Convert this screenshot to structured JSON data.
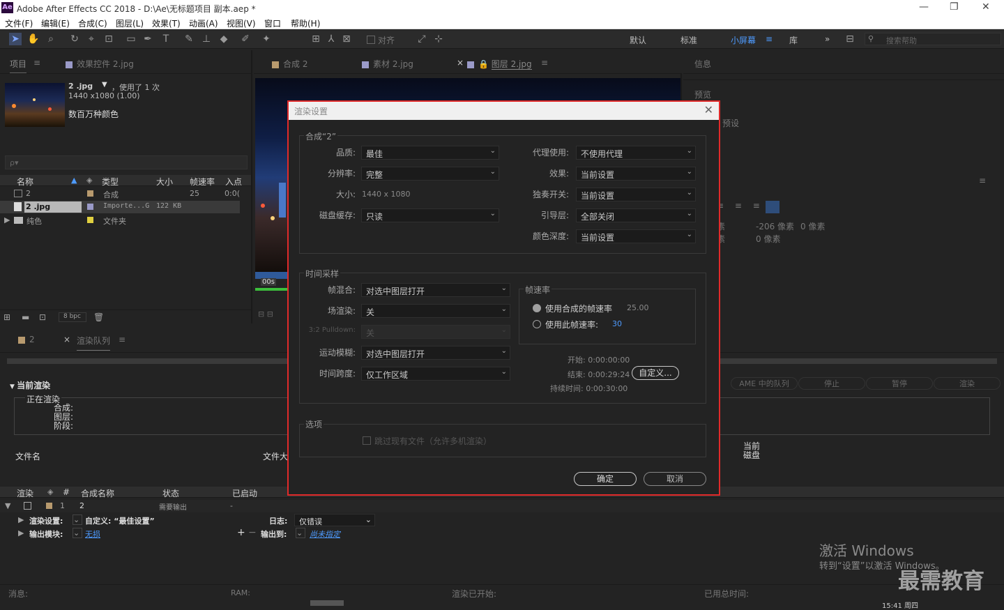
{
  "window": {
    "title": "Adobe After Effects CC 2018 - D:\\Ae\\无标题项目 副本.aep *",
    "logo": "Ae"
  },
  "menu": [
    "文件(F)",
    "编辑(E)",
    "合成(C)",
    "图层(L)",
    "效果(T)",
    "动画(A)",
    "视图(V)",
    "窗口",
    "帮助(H)"
  ],
  "toolbar": {
    "snap_label": "对齐",
    "workspaces": [
      "默认",
      "标准",
      "小屏幕",
      "库"
    ],
    "active_workspace": "小屏幕",
    "search_placeholder": "搜索帮助"
  },
  "project": {
    "tab_project": "项目",
    "tab_effects": "效果控件 2.jpg",
    "file_name": "2 .jpg",
    "file_usage": "，使用了 1 次",
    "file_dims": "1440 x1080 (1.00)",
    "file_colors": "数百万种颜色",
    "search_placeholder": "ρ▾",
    "columns": [
      "名称",
      "类型",
      "大小",
      "帧速率",
      "入点"
    ],
    "rows": [
      {
        "name": "2",
        "color": "#b89a6e",
        "type": "合成",
        "size": "",
        "fps": "25",
        "in": "0:0("
      },
      {
        "name": "2 .jpg",
        "color": "#9a9ac8",
        "type": "Importe...G",
        "size": "122 KB",
        "fps": "",
        "in": ""
      },
      {
        "name": "纯色",
        "color": "#e0d040",
        "type": "文件夹",
        "size": "",
        "fps": "",
        "in": ""
      }
    ],
    "bpc": "8 bpc"
  },
  "viewer": {
    "tabs": [
      "合成 2",
      "素材 2.jpg",
      "图层 2.jpg"
    ],
    "timecode": "00s"
  },
  "info": {
    "title": "信息",
    "preview": "预览",
    "preset": "预设",
    "px1": "-206 像素",
    "px2": "0 像素",
    "px3": "0 像素",
    "px4": "素",
    "px5": "素"
  },
  "render_queue": {
    "tab_comp": "2",
    "tab_queue": "渲染队列",
    "current_render": "当前渲染",
    "rendering": "正在渲染",
    "sub": [
      "合成:",
      "图层:",
      "阶段:"
    ],
    "filename_label": "文件名",
    "filesize_label": "文件大",
    "disk_label": "当前磁盘",
    "buttons": [
      "AME 中的队列",
      "停止",
      "暂停",
      "渲染"
    ],
    "columns": [
      "渲染",
      "#",
      "合成名称",
      "状态",
      "已启动"
    ],
    "row": {
      "num": "1",
      "name": "2",
      "status": "需要输出",
      "started": "-"
    },
    "render_settings_label": "渲染设置:",
    "render_settings_value": "自定义: “最佳设置”",
    "log_label": "日志:",
    "log_value": "仅错误",
    "output_module_label": "输出模块:",
    "output_module_value": "无损",
    "output_to_label": "输出到:",
    "output_to_value": "尚未指定"
  },
  "status": {
    "msg": "消息:",
    "ram": "RAM:",
    "render_started": "渲染已开始:",
    "total_time": "已用总时间:",
    "clock": "15:41 周四"
  },
  "watermark": {
    "activate": "激活 Windows",
    "activate_sub": "转到“设置”以激活 Windows。",
    "brand": "最需教育"
  },
  "dialog": {
    "title": "渲染设置",
    "comp_group": "合成“2”",
    "quality_label": "品质:",
    "quality": "最佳",
    "resolution_label": "分辨率:",
    "resolution": "完整",
    "size_label": "大小:",
    "size": "1440 x 1080",
    "disk_cache_label": "磁盘缓存:",
    "disk_cache": "只读",
    "proxy_label": "代理使用:",
    "proxy": "不使用代理",
    "effects_label": "效果:",
    "effects": "当前设置",
    "solo_label": "独奏开关:",
    "solo": "当前设置",
    "guide_label": "引导层:",
    "guide": "全部关闭",
    "color_depth_label": "颜色深度:",
    "color_depth": "当前设置",
    "time_group": "时间采样",
    "frame_blend_label": "帧混合:",
    "frame_blend": "对选中图层打开",
    "field_label": "场渲染:",
    "field": "关",
    "pulldown_label": "3:2 Pulldown:",
    "pulldown": "关",
    "motion_blur_label": "运动模糊:",
    "motion_blur": "对选中图层打开",
    "time_span_label": "时间跨度:",
    "time_span": "仅工作区域",
    "fps_group": "帧速率",
    "fps_comp_label": "使用合成的帧速率",
    "fps_comp": "25.00",
    "fps_this_label": "使用此帧速率:",
    "fps_this": "30",
    "start": "开始: 0:00:00:00",
    "end": "结束: 0:00:29:24",
    "duration": "持续时间: 0:00:30:00",
    "custom_btn": "自定义...",
    "options_group": "选项",
    "skip_label": "跳过现有文件（允许多机渲染）",
    "ok": "确定",
    "cancel": "取消"
  }
}
